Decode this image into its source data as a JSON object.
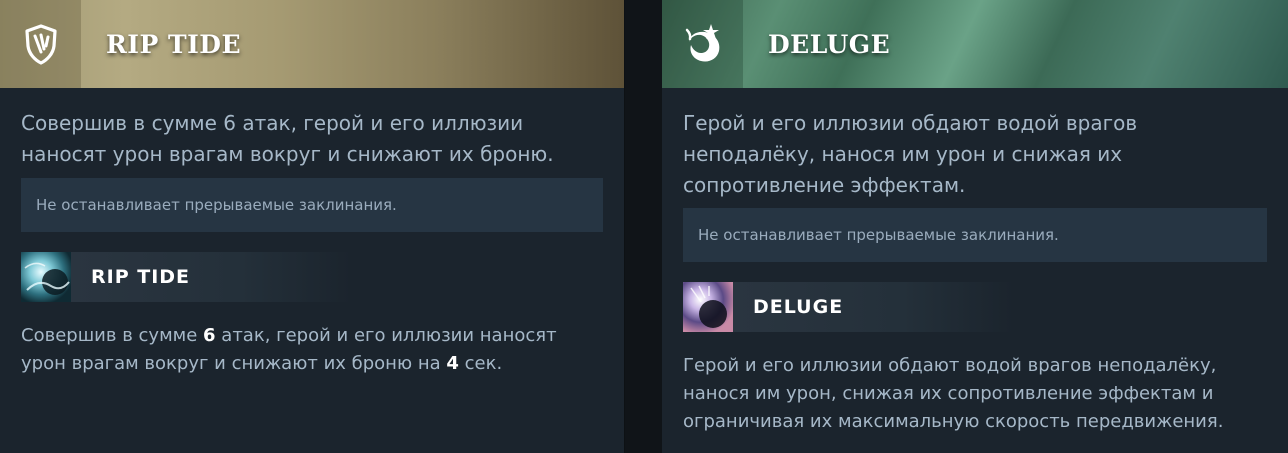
{
  "left": {
    "icon": "shield-claw-icon",
    "title": "RIP TIDE",
    "description": "Совершив в сумме 6 атак, герой и его иллюзии наносят урон врагам вокруг и снижают их броню.",
    "note": "Не останавливает прерываемые заклинания.",
    "ability": {
      "icon": "rip-tide-ability-icon",
      "name": "RIP TIDE",
      "desc_a": "Совершив в сумме ",
      "value_a": "6",
      "desc_b": " атак, герой и его иллюзии наносят урон врагам вокруг и снижают их броню на ",
      "value_b": "4",
      "desc_c": " сек."
    }
  },
  "right": {
    "icon": "flame-splash-icon",
    "title": "DELUGE",
    "description": "Герой и его иллюзии обдают водой врагов неподалёку, нанося им урон и снижая их сопротивление эффектам.",
    "note": "Не останавливает прерываемые заклинания.",
    "ability": {
      "icon": "deluge-ability-icon",
      "name": "DELUGE",
      "desc": "Герой и его иллюзии обдают водой врагов неподалёку, нанося им урон, снижая их сопротивление эффектам и ограничивая их максимальную скорость передвижения."
    }
  },
  "colors": {
    "card_bg": "#1b242d",
    "note_bg": "#263543",
    "text": "#a6b8c8",
    "left_header": "#a29a74",
    "right_header": "#5a8f74"
  }
}
